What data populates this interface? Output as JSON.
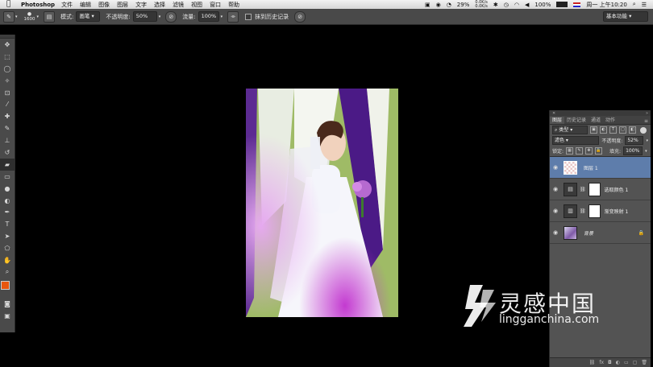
{
  "menubar": {
    "apple_icon": "apple-icon",
    "app_name": "Photoshop",
    "items": [
      "文件",
      "编辑",
      "图像",
      "图层",
      "文字",
      "选择",
      "滤镜",
      "视图",
      "窗口",
      "帮助"
    ],
    "status": {
      "cpu_percent": "29%",
      "net_up": "0.0K/s",
      "net_down": "0.0K/s",
      "battery": "100%",
      "datetime": "周一 上午10:20"
    }
  },
  "optionsbar": {
    "brush_size": "1600",
    "mode_label": "模式:",
    "mode_value": "画笔",
    "opacity_label": "不透明度:",
    "opacity_value": "50%",
    "flow_label": "流量:",
    "flow_value": "100%",
    "history_label": "抹到历史记录",
    "workspace": "基本功能"
  },
  "document": {
    "background": "#000000"
  },
  "layers_panel": {
    "tabs": [
      "图层",
      "历史记录",
      "通道",
      "动作"
    ],
    "active_tab": "图层",
    "filter_label": "类型",
    "blend_mode": "滤色",
    "opacity_label": "不透明度:",
    "opacity_value": "52%",
    "lock_label": "锁定:",
    "fill_label": "填充:",
    "fill_value": "100%",
    "layers": [
      {
        "name": "图层 1",
        "selected": true
      },
      {
        "name": "选取颜色 1",
        "selected": false
      },
      {
        "name": "渐变映射 1",
        "selected": false
      },
      {
        "name": "背景",
        "selected": false
      }
    ]
  },
  "colors": {
    "foreground": "#e8560f",
    "background": "#ffffff",
    "layer_selected": "#5e7dab"
  },
  "watermark": {
    "cn": "灵感中国",
    "url": "lingganchina.com"
  }
}
